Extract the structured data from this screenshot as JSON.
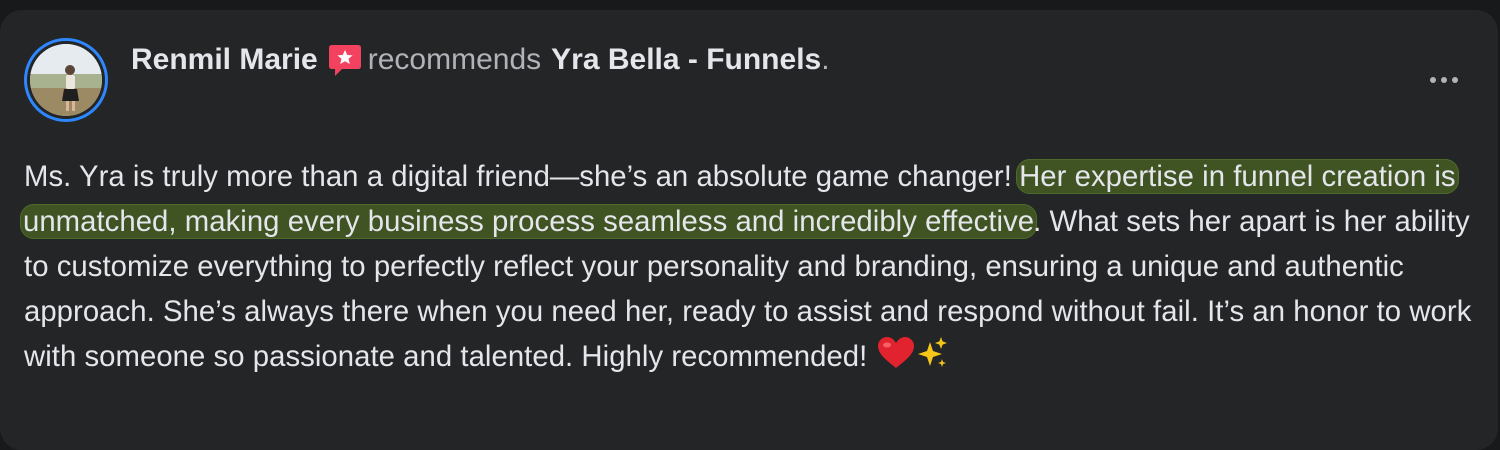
{
  "post": {
    "author": "Renmil Marie",
    "action": "recommends",
    "page_name": "Yra Bella - Funnels",
    "punctuation": ".",
    "icons": {
      "recommend": "recommend-badge-icon",
      "more": "more-options-icon",
      "heart": "red-heart-emoji",
      "sparkles": "sparkles-emoji"
    },
    "text": {
      "before_highlight": "Ms. Yra is truly more than a digital friend—she’s an absolute game changer! ",
      "highlight": "Her expertise in funnel creation is unmatched, making every business process seamless and incredibly effective",
      "after_highlight": ". What sets her apart is her ability to customize everything to perfectly reflect your personality and branding, ensuring a unique and authentic approach. She’s always there when you need her, ready to assist and respond without fail. It’s an honor to work with someone so passionate and talented. Highly recommended! "
    }
  },
  "colors": {
    "background": "#18191a",
    "card": "#242526",
    "primary_text": "#e4e6eb",
    "secondary_text": "#b0b3b8",
    "highlight": "#3f5323",
    "avatar_ring": "#2d88ff",
    "recommend_badge": "#f3425f"
  }
}
